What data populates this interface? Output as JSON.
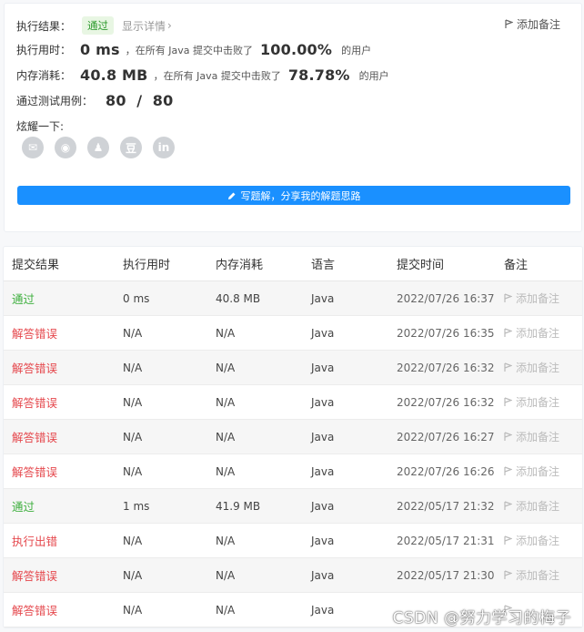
{
  "summary": {
    "result_label": "执行结果：",
    "result_badge": "通过",
    "show_detail": "显示详情",
    "add_note": "添加备注",
    "runtime_label": "执行用时：",
    "runtime_value": "0 ms",
    "runtime_text1": "，在所有 Java 提交中击败了",
    "runtime_percent": "100.00%",
    "runtime_text2": "的用户",
    "memory_label": "内存消耗：",
    "memory_value": "40.8 MB",
    "memory_text1": "，在所有 Java 提交中击败了",
    "memory_percent": "78.78%",
    "memory_text2": "的用户",
    "tests_label": "通过测试用例：",
    "tests_value": "80  /  80",
    "share_label": "炫耀一下:",
    "share_button": "写题解，分享我的解题思路",
    "share_icons": [
      "wechat-icon",
      "weibo-icon",
      "qq-icon",
      "douban-icon",
      "linkedin-icon"
    ],
    "share_glyphs": [
      "✉",
      "◉",
      "♟",
      "豆",
      "in"
    ]
  },
  "table": {
    "headers": [
      "提交结果",
      "执行用时",
      "内存消耗",
      "语言",
      "提交时间",
      "备注"
    ],
    "rows": [
      {
        "status": "通过",
        "ok": true,
        "time": "0 ms",
        "memory": "40.8 MB",
        "lang": "Java",
        "submitted": "2022/07/26 16:37",
        "note": "添加备注"
      },
      {
        "status": "解答错误",
        "ok": false,
        "time": "N/A",
        "memory": "N/A",
        "lang": "Java",
        "submitted": "2022/07/26 16:35",
        "note": "添加备注"
      },
      {
        "status": "解答错误",
        "ok": false,
        "time": "N/A",
        "memory": "N/A",
        "lang": "Java",
        "submitted": "2022/07/26 16:32",
        "note": "添加备注"
      },
      {
        "status": "解答错误",
        "ok": false,
        "time": "N/A",
        "memory": "N/A",
        "lang": "Java",
        "submitted": "2022/07/26 16:32",
        "note": "添加备注"
      },
      {
        "status": "解答错误",
        "ok": false,
        "time": "N/A",
        "memory": "N/A",
        "lang": "Java",
        "submitted": "2022/07/26 16:27",
        "note": "添加备注"
      },
      {
        "status": "解答错误",
        "ok": false,
        "time": "N/A",
        "memory": "N/A",
        "lang": "Java",
        "submitted": "2022/07/26 16:26",
        "note": "添加备注"
      },
      {
        "status": "通过",
        "ok": true,
        "time": "1 ms",
        "memory": "41.9 MB",
        "lang": "Java",
        "submitted": "2022/05/17 21:32",
        "note": "添加备注"
      },
      {
        "status": "执行出错",
        "ok": false,
        "time": "N/A",
        "memory": "N/A",
        "lang": "Java",
        "submitted": "2022/05/17 21:31",
        "note": "添加备注"
      },
      {
        "status": "解答错误",
        "ok": false,
        "time": "N/A",
        "memory": "N/A",
        "lang": "Java",
        "submitted": "2022/05/17 21:30",
        "note": "添加备注"
      },
      {
        "status": "解答错误",
        "ok": false,
        "time": "N/A",
        "memory": "N/A",
        "lang": "Java",
        "submitted": "",
        "note": ""
      }
    ]
  },
  "watermark": "CSDN @努力学习的梅子",
  "colors": {
    "accent": "#1a90ff",
    "success": "#3eaf3e",
    "error": "#e5484d"
  }
}
